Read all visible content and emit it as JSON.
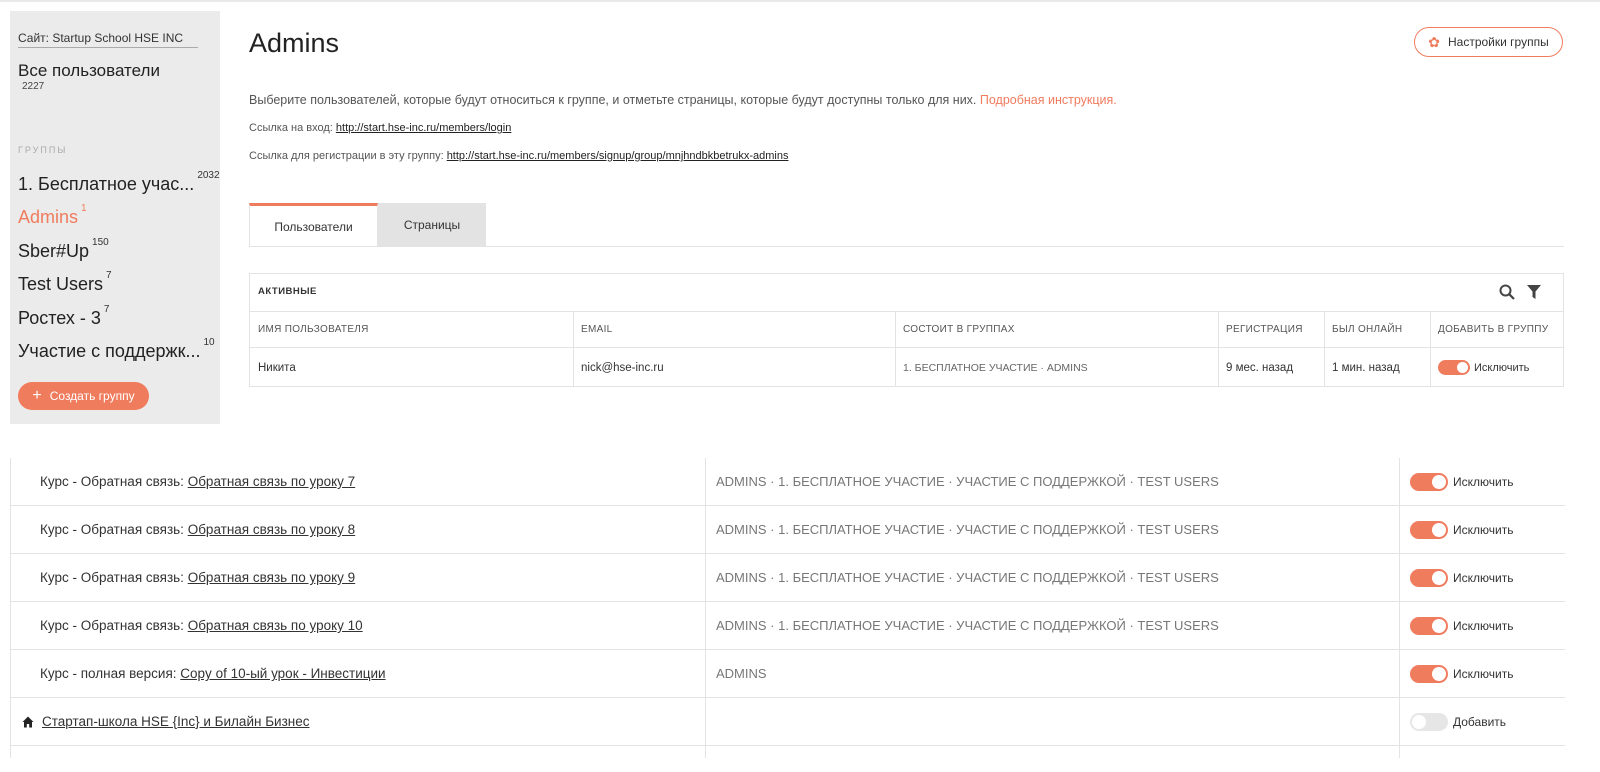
{
  "sidebar": {
    "site_label": "Сайт: Startup School HSE INC",
    "all_users_label": "Все пользователи",
    "all_users_count": "2227",
    "groups_heading": "ГРУППЫ",
    "groups": [
      {
        "label": "1. Бесплатное учас...",
        "count": "2032"
      },
      {
        "label": "Admins",
        "count": "1"
      },
      {
        "label": "Sber#Up",
        "count": "150"
      },
      {
        "label": "Test Users",
        "count": "7"
      },
      {
        "label": "Ростех - 3",
        "count": "7"
      },
      {
        "label": "Участие с поддержк...",
        "count": "10"
      }
    ],
    "create_button": "Создать группу"
  },
  "header": {
    "title": "Admins",
    "settings_button": "Настройки группы",
    "description": "Выберите пользователей, которые будут относиться к группе, и отметьте страницы, которые будут доступны только для них.",
    "instruction_link": "Подробная инструкция.",
    "login_label": "Ссылка на вход:",
    "login_url": "http://start.hse-inc.ru/members/login",
    "signup_label": "Ссылка для регистрации в эту группу:",
    "signup_url": "http://start.hse-inc.ru/members/signup/group/mnjhndbkbetrukx-admins"
  },
  "tabs": [
    "Пользователи",
    "Страницы"
  ],
  "users_table": {
    "title": "АКТИВНЫЕ",
    "columns": [
      "ИМЯ ПОЛЬЗОВАТЕЛЯ",
      "EMAIL",
      "СОСТОИТ В ГРУППАХ",
      "РЕГИСТРАЦИЯ",
      "БЫЛ ОНЛАЙН",
      "ДОБАВИТЬ В ГРУППУ"
    ],
    "rows": [
      {
        "name": "Никита",
        "email": "nick@hse-inc.ru",
        "groups": "1. БЕСПЛАТНОЕ УЧАСТИЕ · ADMINS",
        "registered": "9 мес. назад",
        "online": "1 мин. назад",
        "action": "Исключить",
        "in_group": true
      }
    ]
  },
  "pages_table": {
    "rows": [
      {
        "prefix": "Курс - Обратная связь:",
        "link": "Обратная связь по уроку 7",
        "groups": "ADMINS · 1. БЕСПЛАТНОЕ УЧАСТИЕ · УЧАСТИЕ С ПОДДЕРЖКОЙ · TEST USERS",
        "action": "Исключить",
        "on": true
      },
      {
        "prefix": "Курс - Обратная связь:",
        "link": "Обратная связь по уроку 8",
        "groups": "ADMINS · 1. БЕСПЛАТНОЕ УЧАСТИЕ · УЧАСТИЕ С ПОДДЕРЖКОЙ · TEST USERS",
        "action": "Исключить",
        "on": true
      },
      {
        "prefix": "Курс - Обратная связь:",
        "link": "Обратная связь по уроку 9",
        "groups": "ADMINS · 1. БЕСПЛАТНОЕ УЧАСТИЕ · УЧАСТИЕ С ПОДДЕРЖКОЙ · TEST USERS",
        "action": "Исключить",
        "on": true
      },
      {
        "prefix": "Курс - Обратная связь:",
        "link": "Обратная связь по уроку 10",
        "groups": "ADMINS · 1. БЕСПЛАТНОЕ УЧАСТИЕ · УЧАСТИЕ С ПОДДЕРЖКОЙ · TEST USERS",
        "action": "Исключить",
        "on": true
      },
      {
        "prefix": "Курс - полная версия:",
        "link": "Copy of 10-ый урок - Инвестиции",
        "groups": "ADMINS",
        "action": "Исключить",
        "on": true
      },
      {
        "prefix": "",
        "link": "Стартап-школа HSE {Inc} и Билайн Бизнес",
        "groups": "",
        "action": "Добавить",
        "on": false,
        "icon": "home-icon"
      }
    ]
  },
  "colors": {
    "accent": "#f07c5e",
    "sidebar_bg": "#ebebeb",
    "border": "#e3e3e3"
  }
}
